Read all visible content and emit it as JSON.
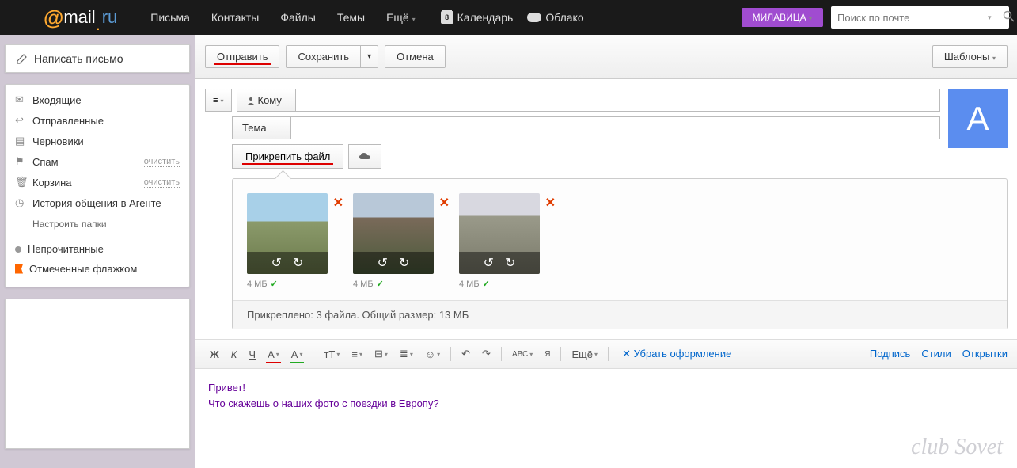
{
  "header": {
    "logo": {
      "at": "@",
      "mail": "mail",
      "dot": ".",
      "ru": "ru"
    },
    "nav": [
      "Письма",
      "Контакты",
      "Файлы",
      "Темы",
      "Ещё"
    ],
    "calendar": {
      "label": "Календарь",
      "day": "8"
    },
    "cloud": "Облако",
    "user": "МИЛАВИЦА",
    "search_placeholder": "Поиск по почте"
  },
  "sidebar": {
    "compose": "Написать письмо",
    "folders": [
      {
        "icon": "inbox",
        "label": "Входящие"
      },
      {
        "icon": "reply",
        "label": "Отправленные"
      },
      {
        "icon": "draft",
        "label": "Черновики"
      },
      {
        "icon": "spam",
        "label": "Спам",
        "clear": "очистить"
      },
      {
        "icon": "trash",
        "label": "Корзина",
        "clear": "очистить"
      },
      {
        "icon": "clock",
        "label": "История общения в Агенте"
      }
    ],
    "settings": "Настроить папки",
    "filters": [
      {
        "type": "dot",
        "label": "Непрочитанные"
      },
      {
        "type": "flag",
        "label": "Отмеченные флажком"
      }
    ]
  },
  "toolbar": {
    "send": "Отправить",
    "save": "Сохранить",
    "cancel": "Отмена",
    "templates": "Шаблоны"
  },
  "compose": {
    "to_label": "Кому",
    "subject_label": "Тема",
    "attach": "Прикрепить файл",
    "avatar_initial": "А"
  },
  "attachments": {
    "items": [
      {
        "size": "4 МБ"
      },
      {
        "size": "4 МБ"
      },
      {
        "size": "4 МБ"
      }
    ],
    "summary": "Прикреплено: 3 файла. Общий размер: 13 МБ"
  },
  "format": {
    "bold": "Ж",
    "italic": "К",
    "underline": "Ч",
    "color_a": "А",
    "bg_a": "А",
    "tt": "тТ",
    "more": "Ещё",
    "remove": "Убрать оформление",
    "sign": "Подпись",
    "styles": "Стили",
    "cards": "Открытки",
    "abc": "АВС",
    "lang": "Я"
  },
  "body": {
    "line1": "Привет!",
    "line2": "Что скажешь о наших фото с поездки в Европу?"
  },
  "watermark": "club Sovet"
}
